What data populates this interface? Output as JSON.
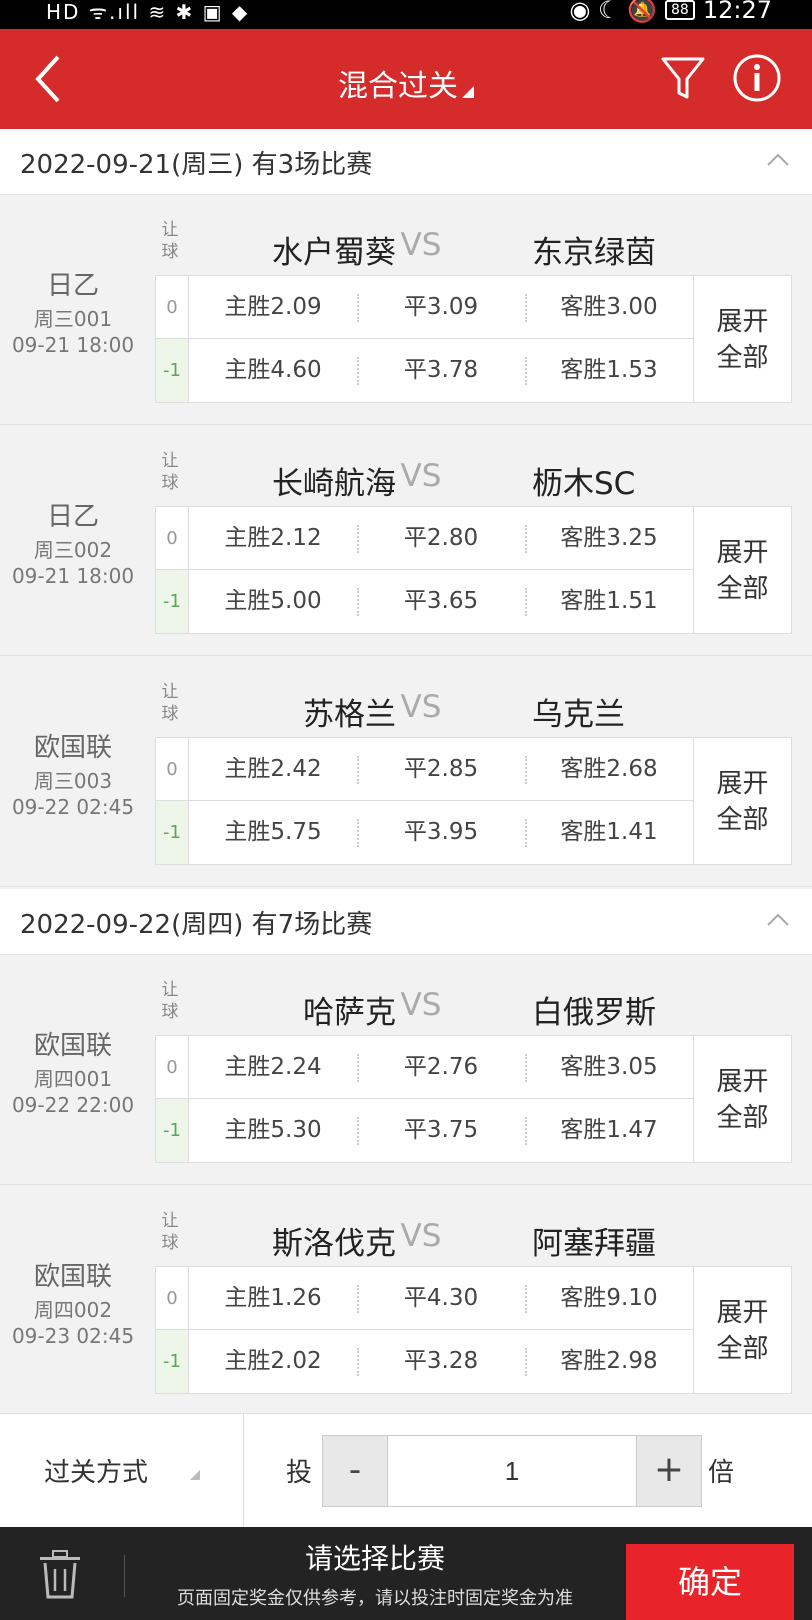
{
  "statusbar": {
    "left": "HD ᯤ.ıll ≋ ✱ ▣ ◆",
    "battery": "88",
    "time": "12:27"
  },
  "header": {
    "title": "混合过关"
  },
  "days": [
    {
      "label": "2022-09-21(周三) 有3场比赛"
    },
    {
      "label": "2022-09-22(周四) 有7场比赛"
    }
  ],
  "rang_label": "让球",
  "vs": "VS",
  "expand_line1": "展开",
  "expand_line2": "全部",
  "matches": [
    {
      "league": "日乙",
      "no": "周三001",
      "time": "09-21 18:00",
      "home": "水户蜀葵",
      "away": "东京绿茵",
      "rows": [
        {
          "h": "0",
          "w": "主胜2.09",
          "d": "平3.09",
          "l": "客胜3.00"
        },
        {
          "h": "-1",
          "w": "主胜4.60",
          "d": "平3.78",
          "l": "客胜1.53"
        }
      ]
    },
    {
      "league": "日乙",
      "no": "周三002",
      "time": "09-21 18:00",
      "home": "长崎航海",
      "away": "枥木SC",
      "rows": [
        {
          "h": "0",
          "w": "主胜2.12",
          "d": "平2.80",
          "l": "客胜3.25"
        },
        {
          "h": "-1",
          "w": "主胜5.00",
          "d": "平3.65",
          "l": "客胜1.51"
        }
      ]
    },
    {
      "league": "欧国联",
      "no": "周三003",
      "time": "09-22 02:45",
      "home": "苏格兰",
      "away": "乌克兰",
      "rows": [
        {
          "h": "0",
          "w": "主胜2.42",
          "d": "平2.85",
          "l": "客胜2.68"
        },
        {
          "h": "-1",
          "w": "主胜5.75",
          "d": "平3.95",
          "l": "客胜1.41"
        }
      ]
    },
    {
      "league": "欧国联",
      "no": "周四001",
      "time": "09-22 22:00",
      "home": "哈萨克",
      "away": "白俄罗斯",
      "rows": [
        {
          "h": "0",
          "w": "主胜2.24",
          "d": "平2.76",
          "l": "客胜3.05"
        },
        {
          "h": "-1",
          "w": "主胜5.30",
          "d": "平3.75",
          "l": "客胜1.47"
        }
      ]
    },
    {
      "league": "欧国联",
      "no": "周四002",
      "time": "09-23 02:45",
      "home": "斯洛伐克",
      "away": "阿塞拜疆",
      "rows": [
        {
          "h": "0",
          "w": "主胜1.26",
          "d": "平4.30",
          "l": "客胜9.10"
        },
        {
          "h": "-1",
          "w": "主胜2.02",
          "d": "平3.28",
          "l": "客胜2.98"
        }
      ]
    }
  ],
  "bottom": {
    "pass_mode": "过关方式",
    "tou": "投",
    "minus": "-",
    "quantity": "1",
    "plus": "+",
    "bei": "倍"
  },
  "footer": {
    "prompt": "请选择比赛",
    "note": "页面固定奖金仅供参考，请以投注时固定奖金为准",
    "confirm": "确定"
  },
  "colors": {
    "brand_red": "#d62b2b",
    "confirm_red": "#e8242a",
    "footer_bg": "#232323"
  }
}
